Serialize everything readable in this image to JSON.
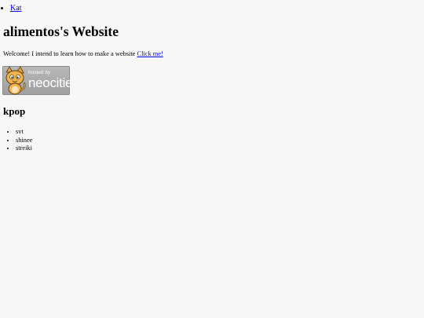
{
  "nav": {
    "items": [
      {
        "label": "Kat"
      }
    ]
  },
  "header": {
    "title": "alimentos's Website"
  },
  "intro": {
    "text": "Welcome! I intend to learn how to make a website ",
    "link_label": "Click me!"
  },
  "badge": {
    "small_text": "hosted by",
    "big_text": "neocities",
    "icon": "neocities-cat-icon"
  },
  "section": {
    "heading": "kpop",
    "items": [
      "svt",
      "shinee",
      "streiki"
    ]
  },
  "colors": {
    "background": "#f7f7f7",
    "link": "#0000ee",
    "badge_gray": "#a8a8a8",
    "cat_orange": "#e8a33a"
  }
}
